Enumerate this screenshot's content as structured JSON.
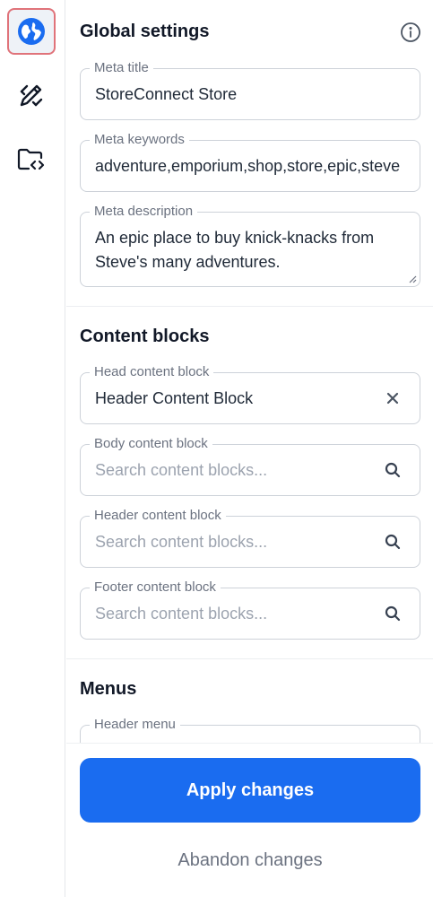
{
  "rail": {
    "items": [
      {
        "icon": "globe-icon",
        "active": true
      },
      {
        "icon": "pen-ruler-icon",
        "active": false
      },
      {
        "icon": "code-folder-icon",
        "active": false
      }
    ]
  },
  "global": {
    "title": "Global settings",
    "meta_title": {
      "label": "Meta title",
      "value": "StoreConnect Store"
    },
    "meta_keywords": {
      "label": "Meta keywords",
      "value": "adventure,emporium,shop,store,epic,steve"
    },
    "meta_description": {
      "label": "Meta description",
      "value": "An epic place to buy knick-knacks from Steve's many adventures."
    }
  },
  "content_blocks": {
    "title": "Content blocks",
    "head": {
      "label": "Head content block",
      "value": "Header Content Block"
    },
    "body": {
      "label": "Body content block",
      "placeholder": "Search content blocks..."
    },
    "header": {
      "label": "Header content block",
      "placeholder": "Search content blocks..."
    },
    "footer": {
      "label": "Footer content block",
      "placeholder": "Search content blocks..."
    }
  },
  "menus": {
    "title": "Menus",
    "header_menu": {
      "label": "Header menu"
    }
  },
  "actions": {
    "apply": "Apply changes",
    "abandon": "Abandon changes"
  },
  "colors": {
    "primary": "#1a6cf0",
    "active_outline": "#e0737a"
  }
}
